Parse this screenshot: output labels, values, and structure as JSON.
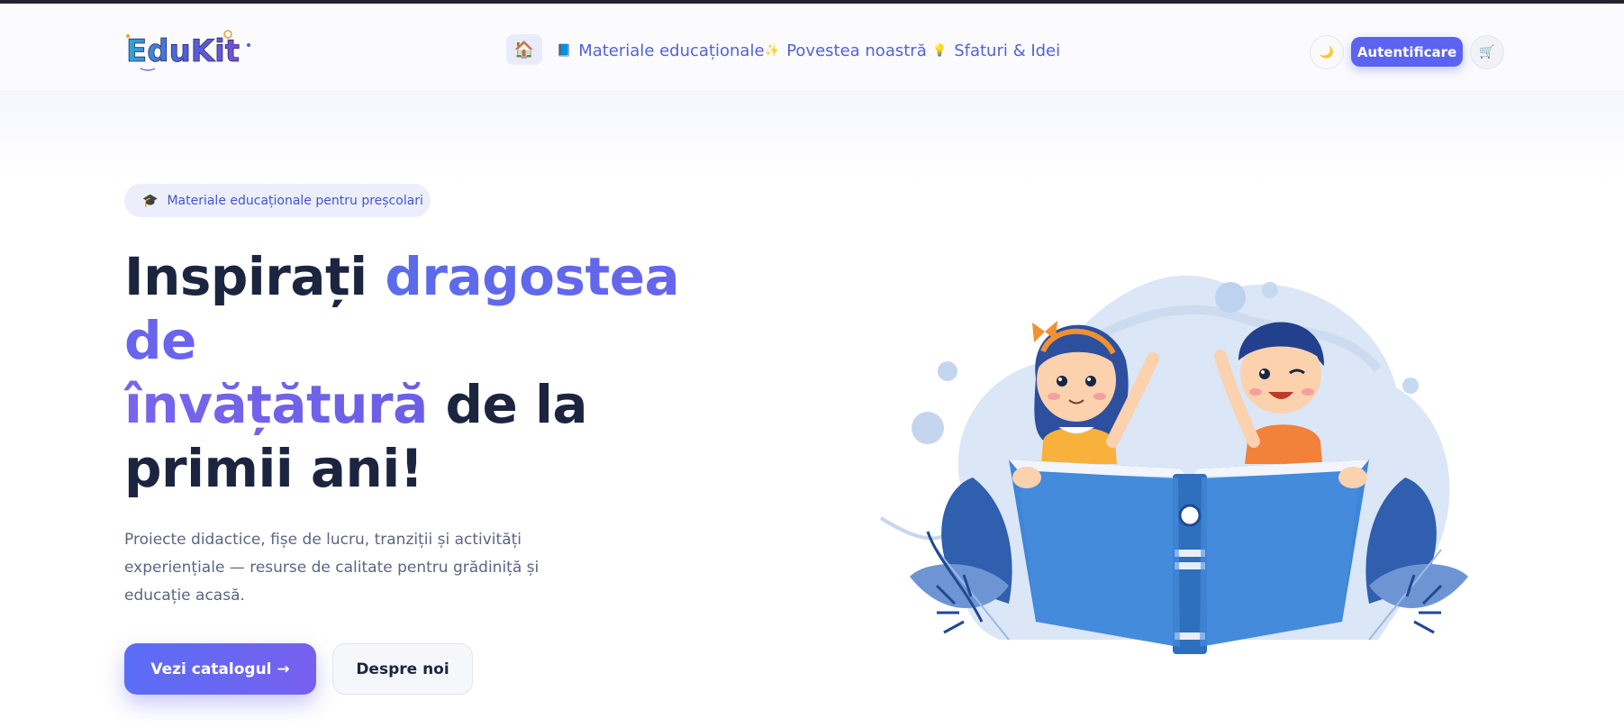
{
  "brand": {
    "logo_text": "EduKit"
  },
  "nav": {
    "home_icon": "house-icon",
    "items": [
      {
        "icon": "books-icon",
        "glyph": "📘",
        "label": "Materiale educaționale"
      },
      {
        "icon": "sparkle-icon",
        "glyph": "✨",
        "label": "Povestea noastră"
      },
      {
        "icon": "lightbulb-icon",
        "glyph": "💡",
        "label": "Sfaturi & Idei"
      }
    ]
  },
  "actions": {
    "theme_icon": "moon-icon",
    "login_label": "Autentificare",
    "cart_icon": "cart-icon"
  },
  "hero": {
    "badge_icon": "graduation-cap-icon",
    "badge_text": "Materiale educaționale pentru preșcolari",
    "title_part1": "Inspirați ",
    "title_highlight1": "dragostea de",
    "title_highlight2": "învățătură",
    "title_part2": " de la primii ani!",
    "lead": "Proiecte didactice, fișe de lucru, tranziții și activități experiențiale — resurse de calitate pentru grădiniță și educație acasă.",
    "primary_button": "Vezi catalogul →",
    "secondary_button": "Despre noi"
  },
  "colors": {
    "accent": "#5b63f0",
    "heading": "#1c2540",
    "nav_link": "#5163d6"
  }
}
